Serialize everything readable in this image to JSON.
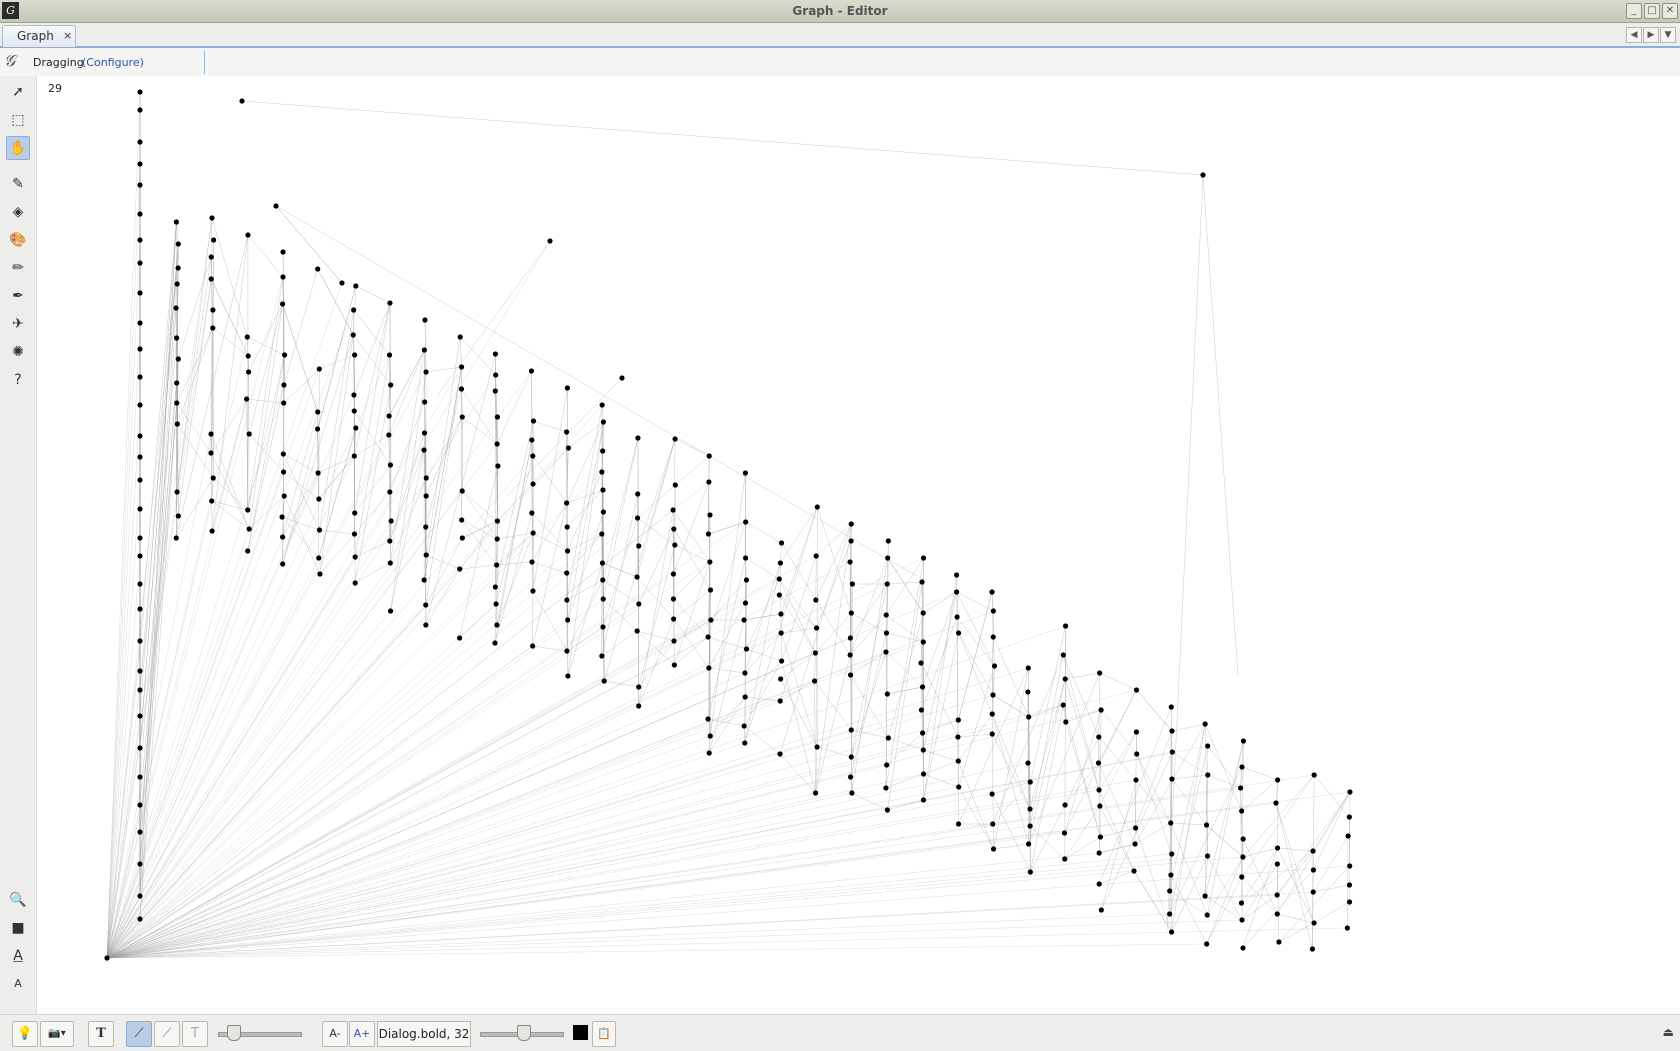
{
  "window": {
    "title": "Graph - Editor",
    "buttons": [
      "_",
      "□",
      "✕"
    ]
  },
  "tabs": [
    {
      "label": "Graph",
      "close": "×"
    }
  ],
  "tab_nav": [
    "◀",
    "▶",
    "▼"
  ],
  "mode_bar": {
    "mode": "Dragging",
    "configure_link": "(Configure)"
  },
  "canvas": {
    "counter": "29",
    "background": "#ffffff",
    "node_color": "#000000",
    "edge_color": "#9a9a9a"
  },
  "left_tools": [
    {
      "name": "pointer-tool",
      "glyph": "➚",
      "active": false
    },
    {
      "name": "rectangle-select-tool",
      "glyph": "⬚",
      "active": false
    },
    {
      "name": "drag-tool",
      "glyph": "✋",
      "active": true
    },
    {
      "name": "painter-tool",
      "glyph": "✎",
      "active": false
    },
    {
      "name": "diamond-tool",
      "glyph": "◈",
      "active": false
    },
    {
      "name": "color-tool",
      "glyph": "🎨",
      "active": false
    },
    {
      "name": "pencil-tool",
      "glyph": "✏",
      "active": false
    },
    {
      "name": "pen-tool",
      "glyph": "✒",
      "active": false
    },
    {
      "name": "airplane-tool",
      "glyph": "✈",
      "active": false
    },
    {
      "name": "gear-tool",
      "glyph": "✺",
      "active": false
    },
    {
      "name": "help-pointer-tool",
      "glyph": "?",
      "active": false
    }
  ],
  "left_bottom_tools": [
    {
      "name": "zoom-tool",
      "glyph": "🔍"
    },
    {
      "name": "background-color-tool",
      "glyph": "■"
    },
    {
      "name": "text-color-tool",
      "glyph": "A"
    },
    {
      "name": "text-size-tool",
      "glyph": "A"
    }
  ],
  "bottom_bar": {
    "font_label": "Dialog.bold, 32",
    "text_button": "T",
    "font_decrease": "A-",
    "font_increase": "A+",
    "color": "#000000",
    "status_icon": "⏏"
  }
}
